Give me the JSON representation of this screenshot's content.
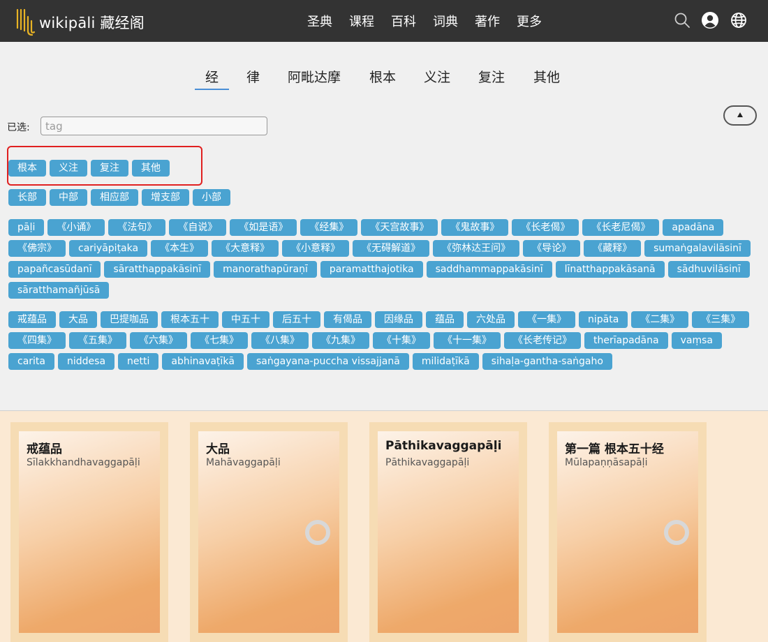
{
  "header": {
    "brand": "wikipāli 藏经阁",
    "nav": [
      "圣典",
      "课程",
      "百科",
      "词典",
      "著作",
      "更多"
    ],
    "icons": [
      "search-icon",
      "user-icon",
      "globe-icon"
    ]
  },
  "tabs": [
    "经",
    "律",
    "阿毗达摩",
    "根本",
    "义注",
    "复注",
    "其他"
  ],
  "active_tab": "经",
  "filter": {
    "selected_label": "已选:",
    "input_placeholder": "tag"
  },
  "tag_groups": {
    "group1": [
      "根本",
      "义注",
      "复注",
      "其他"
    ],
    "group2": [
      "长部",
      "中部",
      "相应部",
      "增支部",
      "小部"
    ],
    "group3": [
      "pāḷi",
      "《小诵》",
      "《法句》",
      "《自说》",
      "《如是语》",
      "《经集》",
      "《天宫故事》",
      "《鬼故事》",
      "《长老偈》",
      "《长老尼偈》",
      "apadāna",
      "《佛宗》",
      "cariyāpiṭaka",
      "《本生》",
      "《大意释》",
      "《小意释》",
      "《无碍解道》",
      "《弥林达王问》",
      "《导论》",
      "《藏释》",
      "sumaṅgalavilāsinī",
      "papañcasūdanī",
      "sāratthappakāsinī",
      "manorathapūraṇī",
      "paramatthajotika",
      "saddhammappakāsinī",
      "līnatthappakāsanā",
      "sādhuvilāsinī",
      "sāratthamañjūsā"
    ],
    "group4": [
      "戒蕴品",
      "大品",
      "巴提咖品",
      "根本五十",
      "中五十",
      "后五十",
      "有偈品",
      "因缘品",
      "蕴品",
      "六处品",
      "《一集》",
      "nipāta",
      "《二集》",
      "《三集》",
      "《四集》",
      "《五集》",
      "《六集》",
      "《七集》",
      "《八集》",
      "《九集》",
      "《十集》",
      "《十一集》",
      "《长老传记》",
      "therīapadāna",
      "vaṃsa",
      "carita",
      "niddesa",
      "netti",
      "abhinavaṭīkā",
      "saṅgayana-puccha vissajjanā",
      "milidaṭīkā",
      "sihaḷa-gantha-saṅgaho"
    ]
  },
  "books": [
    {
      "title": "戒蕴品",
      "subtitle": "Sīlakkhandhavaggapāḷi",
      "loading": false
    },
    {
      "title": "大品",
      "subtitle": "Mahāvaggapāḷi",
      "loading": true
    },
    {
      "title": "Pāthikavaggapāḷi",
      "subtitle": "Pāthikavaggapāḷi",
      "loading": false
    },
    {
      "title": "第一篇 根本五十经",
      "subtitle": "Mūlapaṇṇāsapāḷi",
      "loading": true
    }
  ],
  "colors": {
    "topbar": "#333333",
    "chip": "#4aa3d1",
    "highlight": "#e02020",
    "tab_underline": "#4a8fd6",
    "books_bg": "#fbe9d3"
  }
}
